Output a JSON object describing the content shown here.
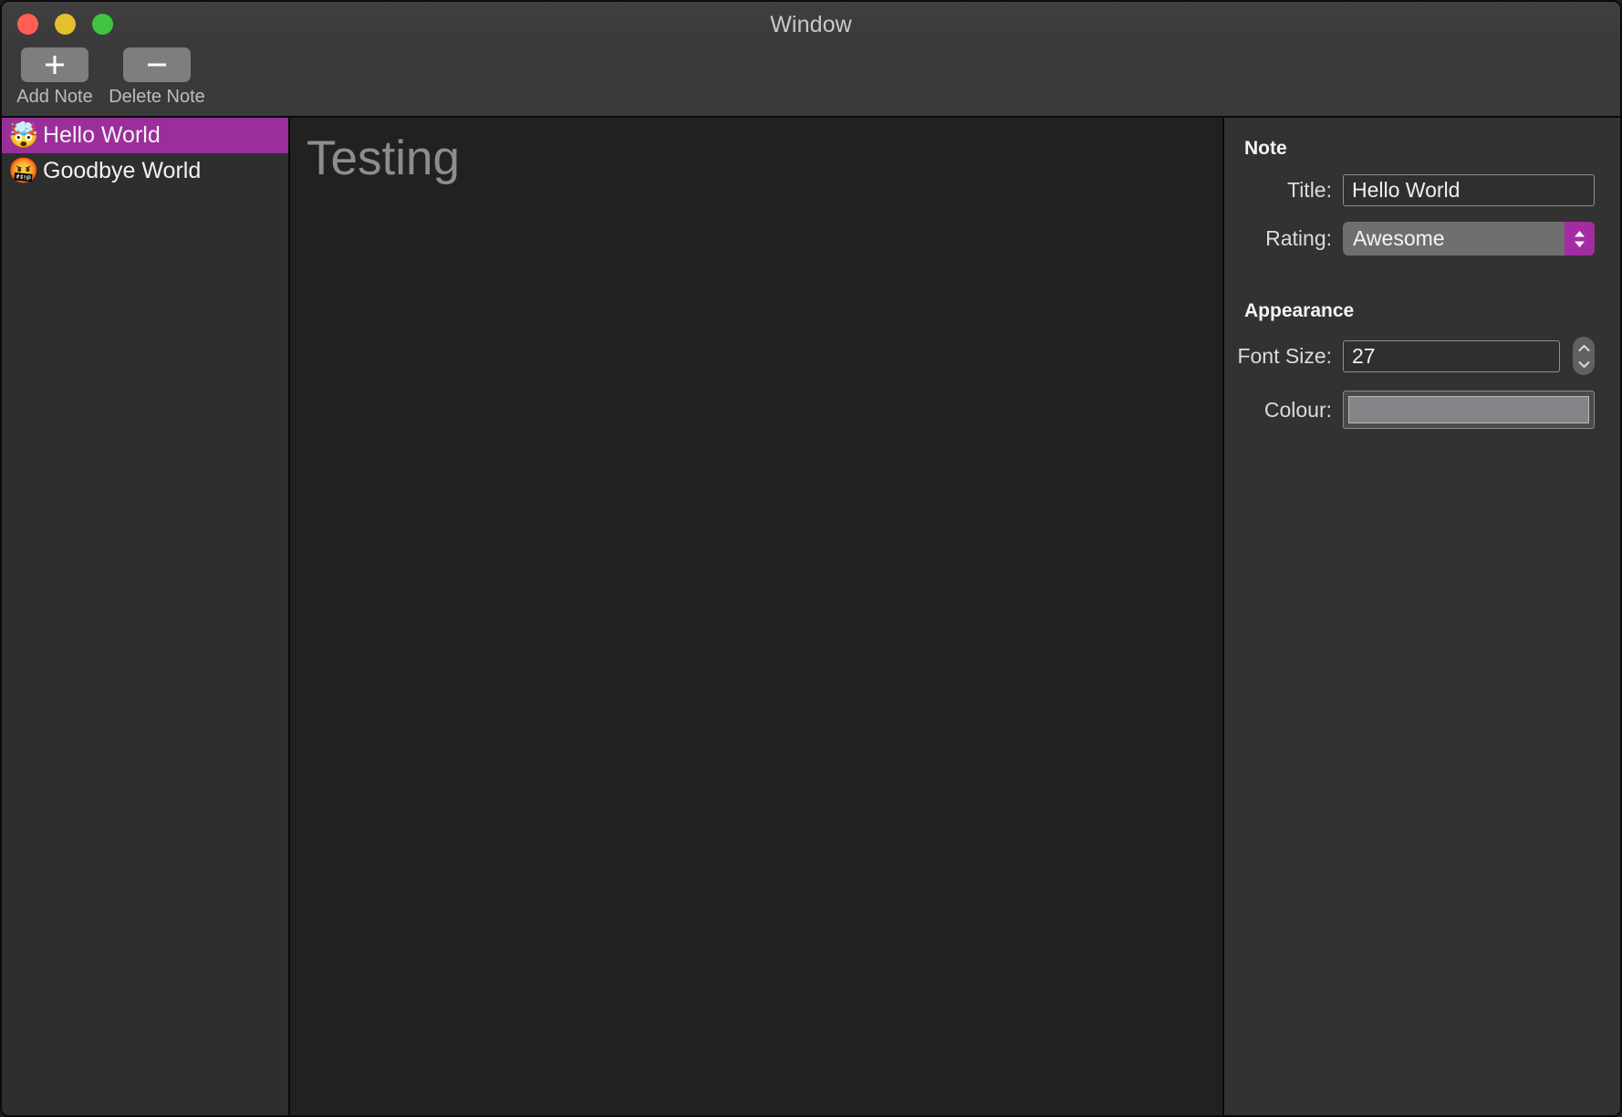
{
  "window": {
    "title": "Window",
    "traffic_lights": [
      {
        "name": "close",
        "color": "#ff5f56"
      },
      {
        "name": "minimize",
        "color": "#e5c02e"
      },
      {
        "name": "maximize",
        "color": "#41c540"
      }
    ]
  },
  "toolbar": {
    "add_label": "Add Note",
    "add_icon": "plus-icon",
    "delete_label": "Delete Note",
    "delete_icon": "minus-icon"
  },
  "sidebar": {
    "notes": [
      {
        "emoji": "🤯",
        "title": "Hello World",
        "selected": true
      },
      {
        "emoji": "🤬",
        "title": "Goodbye World",
        "selected": false
      }
    ],
    "selection_color": "#9a2e9a"
  },
  "editor": {
    "text": "Testing",
    "text_color": "#8d8d8d",
    "font_size_px": 53
  },
  "inspector": {
    "note_section": {
      "heading": "Note",
      "title_label": "Title:",
      "title_value": "Hello World",
      "title_placeholder": "Title",
      "rating_label": "Rating:",
      "rating_value": "Awesome",
      "rating_options": [
        "Awesome"
      ],
      "rating_accent_color": "#a32ca3",
      "rating_arrows_icon": "chevron-up-down-icon"
    },
    "appearance_section": {
      "heading": "Appearance",
      "font_size_label": "Font Size:",
      "font_size_value": "27",
      "stepper_icon": "stepper-up-down-icon",
      "colour_label": "Colour:",
      "colour_value": "#848489"
    }
  }
}
